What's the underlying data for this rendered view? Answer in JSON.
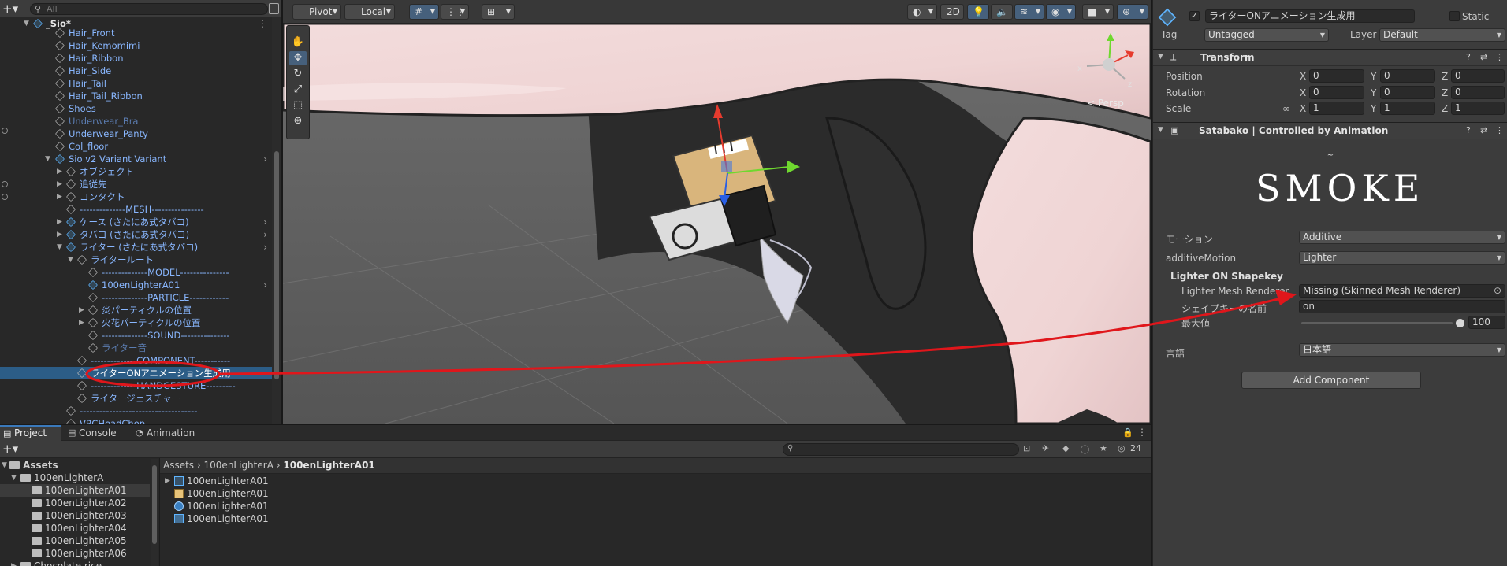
{
  "hierarchy": {
    "search_placeholder": "All",
    "root_label": "_Sio*",
    "items": [
      {
        "label": "Hair_Front"
      },
      {
        "label": "Hair_Kemomimi"
      },
      {
        "label": "Hair_Ribbon"
      },
      {
        "label": "Hair_Side"
      },
      {
        "label": "Hair_Tail"
      },
      {
        "label": "Hair_Tail_Ribbon"
      },
      {
        "label": "Shoes"
      },
      {
        "label": "Underwear_Bra"
      },
      {
        "label": "Underwear_Panty"
      },
      {
        "label": "Col_floor"
      },
      {
        "label": "Sio v2 Variant Variant"
      },
      {
        "label": "オブジェクト"
      },
      {
        "label": "追従先"
      },
      {
        "label": "コンタクト"
      },
      {
        "label": "--------------MESH----------------"
      },
      {
        "label": "ケース (さたにあ式タバコ)"
      },
      {
        "label": "タバコ (さたにあ式タバコ)"
      },
      {
        "label": "ライター (さたにあ式タバコ)"
      },
      {
        "label": "ライタールート"
      },
      {
        "label": "--------------MODEL---------------"
      },
      {
        "label": "100enLighterA01"
      },
      {
        "label": "--------------PARTICLE------------"
      },
      {
        "label": "炎パーティクルの位置"
      },
      {
        "label": "火花パーティクルの位置"
      },
      {
        "label": "--------------SOUND---------------"
      },
      {
        "label": "ライター音"
      },
      {
        "label": "--------------COMPONENT-----------"
      },
      {
        "label": "ライターONアニメーション生成用"
      },
      {
        "label": "--------------HANDGESTURE---------"
      },
      {
        "label": "ライタージェスチャー"
      },
      {
        "label": "------------------------------------"
      },
      {
        "label": "VRCHeadChop"
      }
    ]
  },
  "scene": {
    "toolbar": {
      "pivot": "Pivot",
      "local": "Local",
      "mode_2d": "2D"
    },
    "persp_label": "< Persp",
    "gizmo_axes": {
      "x": "x",
      "y": "y",
      "z": "z"
    }
  },
  "inspector": {
    "object_name": "ライターONアニメーション生成用",
    "static_label": "Static",
    "tag_label": "Tag",
    "tag_value": "Untagged",
    "layer_label": "Layer",
    "layer_value": "Default",
    "transform": {
      "title": "Transform",
      "rows": [
        {
          "label": "Position",
          "x": "0",
          "y": "0",
          "z": "0"
        },
        {
          "label": "Rotation",
          "x": "0",
          "y": "0",
          "z": "0"
        },
        {
          "label": "Scale",
          "x": "1",
          "y": "1",
          "z": "1"
        }
      ],
      "axis_x": "X",
      "axis_y": "Y",
      "axis_z": "Z"
    },
    "satabako": {
      "title": "Satabako | Controlled by Animation",
      "logo_text": "SMOKE",
      "motion_label": "モーション",
      "motion_value": "Additive",
      "additive_label": "additiveMotion",
      "additive_value": "Lighter",
      "section_title": "Lighter ON Shapekey",
      "mesh_label": "Lighter Mesh Renderer",
      "mesh_value": "Missing (Skinned Mesh Renderer)",
      "shapekey_label": "シェイプキーの名前",
      "shapekey_value": "on",
      "max_label": "最大値",
      "max_value": "100",
      "lang_label": "言語",
      "lang_value": "日本語"
    },
    "add_component": "Add Component"
  },
  "project": {
    "tabs": [
      {
        "label": "Project"
      },
      {
        "label": "Console"
      },
      {
        "label": "Animation"
      }
    ],
    "badge_count": "24",
    "tree": [
      {
        "label": "Assets"
      },
      {
        "label": "100enLighterA"
      },
      {
        "label": "100enLighterA01"
      },
      {
        "label": "100enLighterA02"
      },
      {
        "label": "100enLighterA03"
      },
      {
        "label": "100enLighterA04"
      },
      {
        "label": "100enLighterA05"
      },
      {
        "label": "100enLighterA06"
      },
      {
        "label": "Chocolate rice"
      }
    ],
    "breadcrumb": {
      "part1": "Assets",
      "part2": "100enLighterA",
      "part3": "100enLighterA01"
    },
    "files": [
      {
        "label": "100enLighterA01"
      },
      {
        "label": "100enLighterA01"
      },
      {
        "label": "100enLighterA01"
      },
      {
        "label": "100enLighterA01"
      }
    ]
  },
  "colors": {
    "selection": "#2c5d87",
    "prefab_text": "#89b7ff",
    "annotation": "#e0161b",
    "accent": "#3a79bb"
  }
}
